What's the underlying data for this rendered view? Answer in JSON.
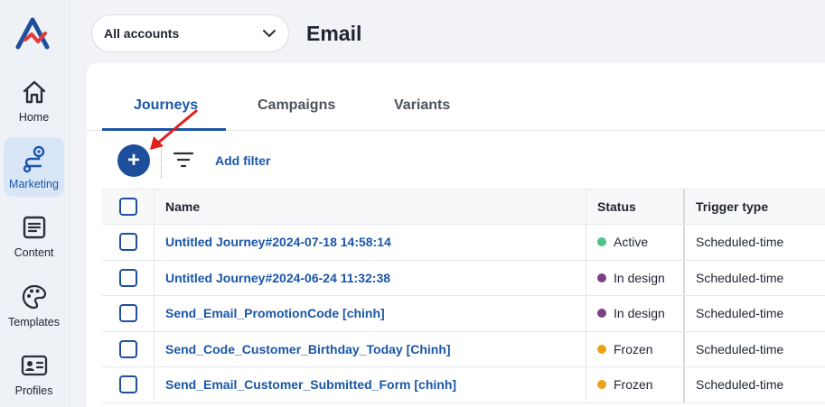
{
  "sidebar": {
    "items": [
      {
        "label": "Home",
        "icon": "home-icon"
      },
      {
        "label": "Marketing",
        "icon": "route-icon",
        "active": true
      },
      {
        "label": "Content",
        "icon": "document-icon"
      },
      {
        "label": "Templates",
        "icon": "palette-icon"
      },
      {
        "label": "Profiles",
        "icon": "id-card-icon"
      }
    ]
  },
  "header": {
    "account_select": "All accounts",
    "title": "Email"
  },
  "tabs": [
    {
      "label": "Journeys",
      "active": true
    },
    {
      "label": "Campaigns"
    },
    {
      "label": "Variants"
    }
  ],
  "toolbar": {
    "add_icon": "+",
    "add_filter": "Add filter"
  },
  "table": {
    "columns": [
      "Name",
      "Status",
      "Trigger type"
    ],
    "rows": [
      {
        "name": "Untitled Journey#2024-07-18 14:58:14",
        "status": "Active",
        "status_color": "#4cc38a",
        "trigger": "Scheduled-time"
      },
      {
        "name": "Untitled Journey#2024-06-24 11:32:38",
        "status": "In design",
        "status_color": "#7b3f86",
        "trigger": "Scheduled-time"
      },
      {
        "name": "Send_Email_PromotionCode [chinh]",
        "status": "In design",
        "status_color": "#7b3f86",
        "trigger": "Scheduled-time"
      },
      {
        "name": "Send_Code_Customer_Birthday_Today [Chinh]",
        "status": "Frozen",
        "status_color": "#e8a317",
        "trigger": "Scheduled-time"
      },
      {
        "name": "Send_Email_Customer_Submitted_Form [chinh]",
        "status": "Frozen",
        "status_color": "#e8a317",
        "trigger": "Scheduled-time"
      }
    ]
  },
  "colors": {
    "accent": "#1a56a8",
    "annotation_arrow": "#e0201b"
  }
}
